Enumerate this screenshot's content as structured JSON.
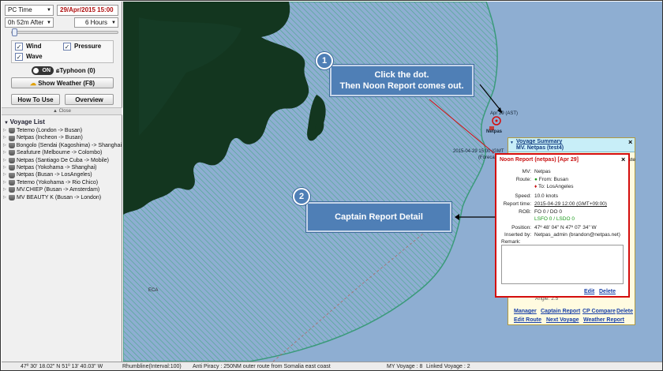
{
  "left_panel": {
    "time_mode": "PC Time",
    "date": "29/Apr/2015 15:00",
    "offset": "0h 52m After",
    "interval": "6 Hours",
    "layers": {
      "wind": "Wind",
      "pressure": "Pressure",
      "wave": "Wave"
    },
    "toggle_state": "ON",
    "typhoon": "Typhoon (0)",
    "show_weather": "Show Weather (F8)",
    "how_to_use": "How To Use",
    "overview": "Overview",
    "close": "Close",
    "voyage_list_title": "Voyage List",
    "voyages": [
      "Tetemo (London -> Busan)",
      "Netpas (Incheon -> Busan)",
      "Bongolo (Sendai (Kagoshima) -> Shanghai",
      "Seafuture (Melbourne -> Colombo)",
      "Netpas (Santiago De Cuba -> Mobile)",
      "Netpas (Yokohama -> Shanghai)",
      "Netpas (Busan -> LosAngeles)",
      "Tetemo (Yokohama -> Rio Chico)",
      "MV.CHIEP (Busan -> Amsterdam)",
      "MV BEAUTY K (Busan -> London)"
    ]
  },
  "map": {
    "point_label_1": "Apr 29 (AST)",
    "ship_label": "Netpas",
    "forecast_label_1": "2015-04-29 15:00 (GMT",
    "forecast_label_2": "(Forecast",
    "eca_label": "ECA",
    "callout1": {
      "number": "1",
      "line1": "Click the dot.",
      "line2": "Then Noon Report comes out."
    },
    "callout2": {
      "number": "2",
      "text": "Captain Report Detail"
    }
  },
  "voyage_summary": {
    "title": "Voyage Summary",
    "subtitle": "MV. Netpas (test4)",
    "side_text_1": "ute",
    "angle_label": "Angle:",
    "angle_value": "2.5",
    "links": [
      "Manager",
      "Captain Report",
      "CP Compare",
      "Delete",
      "Edit Route",
      "Next Voyage",
      "Weather Report"
    ]
  },
  "noon_report": {
    "title": "Noon Report (netpas)   [Apr 29]",
    "mv_label": "MV:",
    "mv": "Netpas",
    "route_label": "Route:",
    "from": "From:  Busan",
    "to": "To:  LosAngeles",
    "speed_label": "Speed:",
    "speed": "10.0 knots",
    "report_time_label": "Report time:",
    "report_time": "2015-04-29 12:00 (GMT+09:00)",
    "rob_label": "ROB:",
    "rob_1": "FO 0 / DO 0",
    "rob_2": "LSFO 0 / LSDO 0",
    "position_label": "Position:",
    "position": "47º 48' 04\" N   47º 07' 34\" W",
    "inserted_label": "Inserted by:",
    "inserted": "Netpas_admin (brandon@netpas.net)",
    "remark_label": "Remark:",
    "edit": "Edit",
    "delete": "Delete"
  },
  "status_bar": {
    "coords": "47º 30' 18.02\" N   51º 13' 40.03\" W",
    "route_type": "Rhumbline(Interval:100)",
    "anti_piracy": "Anti Piracy : 250NM outer route from Somalia east coast",
    "my_voyage": "MY Voyage : 8",
    "linked_voyage": "Linked Voyage : 2"
  },
  "colors": {
    "sea": "#8eaed2",
    "land": "#13361f",
    "hatch_line": "#5fc9a4",
    "callout": "#4f7fb6",
    "report_border": "#d40c0c",
    "link": "#1840a8"
  }
}
